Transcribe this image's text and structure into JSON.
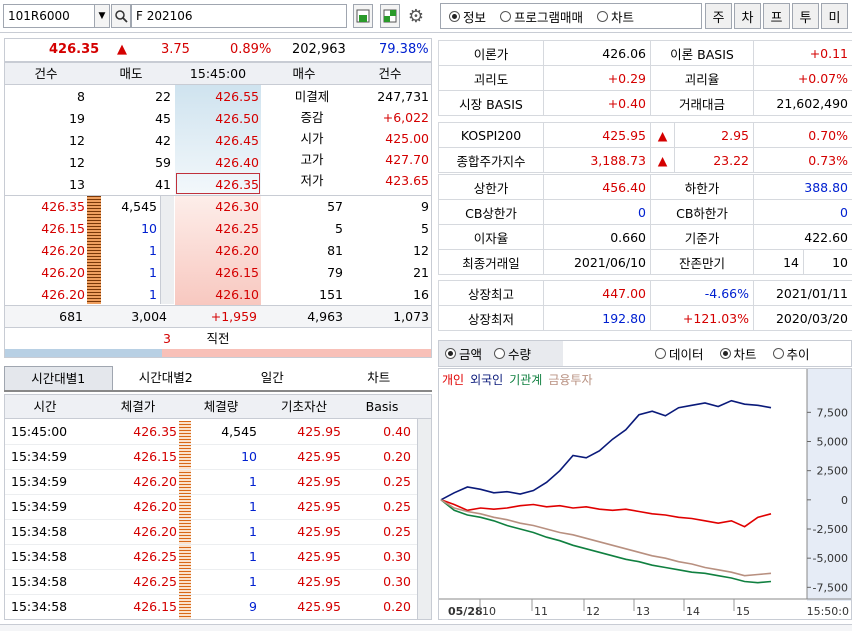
{
  "toolbar": {
    "code": "101R6000",
    "name": "F 202106",
    "radios": [
      {
        "label": "정보",
        "on": true
      },
      {
        "label": "프로그램매매",
        "on": false
      },
      {
        "label": "차트",
        "on": false
      }
    ],
    "tabs": [
      "주",
      "차",
      "프",
      "투",
      "미"
    ]
  },
  "quote": {
    "price": "426.35",
    "arrow": "▲",
    "change": "3.75",
    "rate": "0.89%",
    "volume": "202,963",
    "ratio": "79.38%"
  },
  "ob": {
    "headers": [
      "건수",
      "매도",
      "15:45:00",
      "매수",
      "건수"
    ],
    "asks": [
      [
        "8",
        "22",
        "426.55"
      ],
      [
        "19",
        "45",
        "426.50"
      ],
      [
        "12",
        "42",
        "426.45"
      ],
      [
        "12",
        "59",
        "426.40"
      ],
      [
        "13",
        "41",
        "426.35"
      ]
    ],
    "info": [
      [
        "미결제",
        "247,731"
      ],
      [
        "증감",
        "+6,022"
      ],
      [
        "시가",
        "425.00"
      ],
      [
        "고가",
        "427.70"
      ],
      [
        "저가",
        "423.65"
      ]
    ],
    "ticks": [
      [
        "426.35",
        "4,545"
      ],
      [
        "426.15",
        "10"
      ],
      [
        "426.20",
        "1"
      ],
      [
        "426.20",
        "1"
      ],
      [
        "426.20",
        "1"
      ]
    ],
    "bids": [
      [
        "426.30",
        "57",
        "9"
      ],
      [
        "426.25",
        "5",
        "5"
      ],
      [
        "426.20",
        "81",
        "12"
      ],
      [
        "426.15",
        "79",
        "21"
      ],
      [
        "426.10",
        "151",
        "16"
      ]
    ],
    "totals": [
      "681",
      "3,004",
      "+1,959",
      "4,963",
      "1,073"
    ],
    "last": [
      "3",
      "직전"
    ]
  },
  "tabs2": [
    "시간대별1",
    "시간대별2",
    "일간",
    "차트"
  ],
  "trades": {
    "headers": [
      "시간",
      "체결가",
      "체결량",
      "기초자산",
      "Basis"
    ],
    "rows": [
      [
        "15:45:00",
        "426.35",
        "4,545",
        "425.95",
        "0.40"
      ],
      [
        "15:34:59",
        "426.15",
        "10",
        "425.95",
        "0.20"
      ],
      [
        "15:34:59",
        "426.20",
        "1",
        "425.95",
        "0.25"
      ],
      [
        "15:34:59",
        "426.20",
        "1",
        "425.95",
        "0.25"
      ],
      [
        "15:34:58",
        "426.20",
        "1",
        "425.95",
        "0.25"
      ],
      [
        "15:34:58",
        "426.25",
        "1",
        "425.95",
        "0.30"
      ],
      [
        "15:34:58",
        "426.25",
        "1",
        "425.95",
        "0.30"
      ],
      [
        "15:34:58",
        "426.15",
        "9",
        "425.95",
        "0.20"
      ]
    ]
  },
  "info": {
    "block1": [
      [
        "이론가",
        "426.06",
        "이론 BASIS",
        "+0.11"
      ],
      [
        "괴리도",
        "+0.29",
        "괴리율",
        "+0.07%"
      ],
      [
        "시장 BASIS",
        "+0.40",
        "거래대금",
        "21,602,490"
      ]
    ],
    "block2": [
      [
        "KOSPI200",
        "425.95",
        "▲",
        "2.95",
        "0.70%"
      ],
      [
        "종합주가지수",
        "3,188.73",
        "▲",
        "23.22",
        "0.73%"
      ]
    ],
    "block3": [
      [
        "상한가",
        "456.40",
        "하한가",
        "388.80"
      ],
      [
        "CB상한가",
        "0",
        "CB하한가",
        "0"
      ],
      [
        "이자율",
        "0.660",
        "기준가",
        "422.60"
      ],
      [
        "최종거래일",
        "2021/06/10",
        "잔존만기",
        "14",
        "10"
      ]
    ],
    "block4": [
      [
        "상장최고",
        "447.00",
        "-4.66%",
        "2021/01/11"
      ],
      [
        "상장최저",
        "192.80",
        "+121.03%",
        "2020/03/20"
      ]
    ]
  },
  "chartbar": {
    "left": [
      {
        "label": "금액",
        "on": true
      },
      {
        "label": "수량",
        "on": false
      }
    ],
    "right": [
      {
        "label": "데이터",
        "on": false
      },
      {
        "label": "차트",
        "on": true
      },
      {
        "label": "추이",
        "on": false
      }
    ]
  },
  "chart_data": {
    "type": "line",
    "legend": [
      "개인",
      "외국인",
      "기관계",
      "금융투자"
    ],
    "colors": [
      "#e00000",
      "#0a1a7a",
      "#108040",
      "#b89080"
    ],
    "x_labels": [
      "05/28",
      "10",
      "11",
      "12",
      "13",
      "14",
      "15",
      "15:50:0"
    ],
    "y_ticks": [
      "7,500",
      "5,000",
      "2,500",
      "0",
      "-2,500",
      "-5,000",
      "-7,500"
    ],
    "ylim": [
      -8500,
      9500
    ],
    "series": [
      {
        "name": "개인",
        "values": [
          0,
          -400,
          -900,
          -700,
          -800,
          -700,
          -500,
          -400,
          -600,
          -500,
          -700,
          -600,
          -800,
          -900,
          -800,
          -1000,
          -1200,
          -1300,
          -1500,
          -1600,
          -1800,
          -2000,
          -1800,
          -2300,
          -1500,
          -1200
        ]
      },
      {
        "name": "외국인",
        "values": [
          0,
          600,
          1100,
          900,
          600,
          700,
          500,
          800,
          1500,
          2500,
          3800,
          3600,
          4200,
          5200,
          6000,
          7300,
          7600,
          7200,
          7900,
          8100,
          8300,
          8000,
          8500,
          8200,
          8100,
          7900
        ]
      },
      {
        "name": "기관계",
        "values": [
          0,
          -900,
          -1300,
          -1500,
          -1800,
          -2200,
          -2500,
          -2800,
          -3200,
          -3500,
          -3900,
          -4200,
          -4500,
          -4800,
          -5100,
          -5300,
          -5600,
          -5800,
          -6000,
          -6200,
          -6300,
          -6500,
          -6700,
          -7000,
          -7100,
          -7000
        ]
      },
      {
        "name": "금융투자",
        "values": [
          0,
          -700,
          -1000,
          -1200,
          -1500,
          -1700,
          -2000,
          -2200,
          -2500,
          -2800,
          -3000,
          -3300,
          -3600,
          -3900,
          -4200,
          -4500,
          -4800,
          -5000,
          -5300,
          -5500,
          -5800,
          -6000,
          -6200,
          -6500,
          -6400,
          -6300
        ]
      }
    ]
  }
}
